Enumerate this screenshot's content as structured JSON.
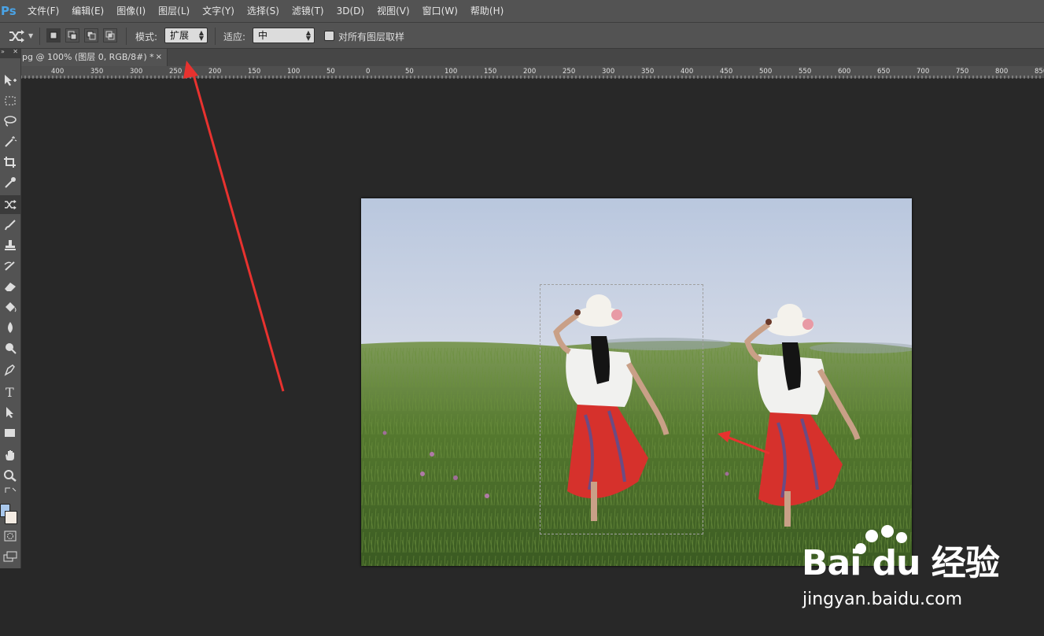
{
  "app": {
    "logo": "Ps",
    "menu": [
      "文件(F)",
      "编辑(E)",
      "图像(I)",
      "图层(L)",
      "文字(Y)",
      "选择(S)",
      "滤镜(T)",
      "3D(D)",
      "视图(V)",
      "窗口(W)",
      "帮助(H)"
    ]
  },
  "options": {
    "tool_icon": "content-aware-move-icon",
    "mode_label": "模式:",
    "mode_value": "扩展",
    "adapt_label": "适应:",
    "adapt_value": "中",
    "sample_all_layers_label": "对所有图层取样",
    "sample_all_layers_checked": false
  },
  "document": {
    "tab_title": "pg @ 100% (图层 0, RGB/8#) *",
    "close": "×"
  },
  "ruler": {
    "labels": [
      "400",
      "350",
      "300",
      "250",
      "200",
      "150",
      "100",
      "50",
      "0",
      "50",
      "100",
      "150",
      "200",
      "250",
      "300",
      "350",
      "400",
      "450",
      "500",
      "550",
      "600",
      "650",
      "700",
      "750",
      "800",
      "850"
    ]
  },
  "toolbar": {
    "tools": [
      "move-icon",
      "rectangular-marquee-icon",
      "lasso-icon",
      "magic-wand-icon",
      "crop-icon",
      "eyedropper-icon",
      "content-aware-move-icon",
      "brush-icon",
      "clone-stamp-icon",
      "history-brush-icon",
      "eraser-icon",
      "paint-bucket-icon",
      "blur-icon",
      "dodge-icon",
      "pen-icon",
      "type-icon",
      "path-selection-icon",
      "rectangle-icon",
      "hand-icon",
      "zoom-icon"
    ],
    "foreground_color": "#a9c8ec",
    "background_color": "#f3ebe2"
  },
  "watermark": {
    "brand": "Bai du 经验",
    "url": "jingyan.baidu.com"
  }
}
